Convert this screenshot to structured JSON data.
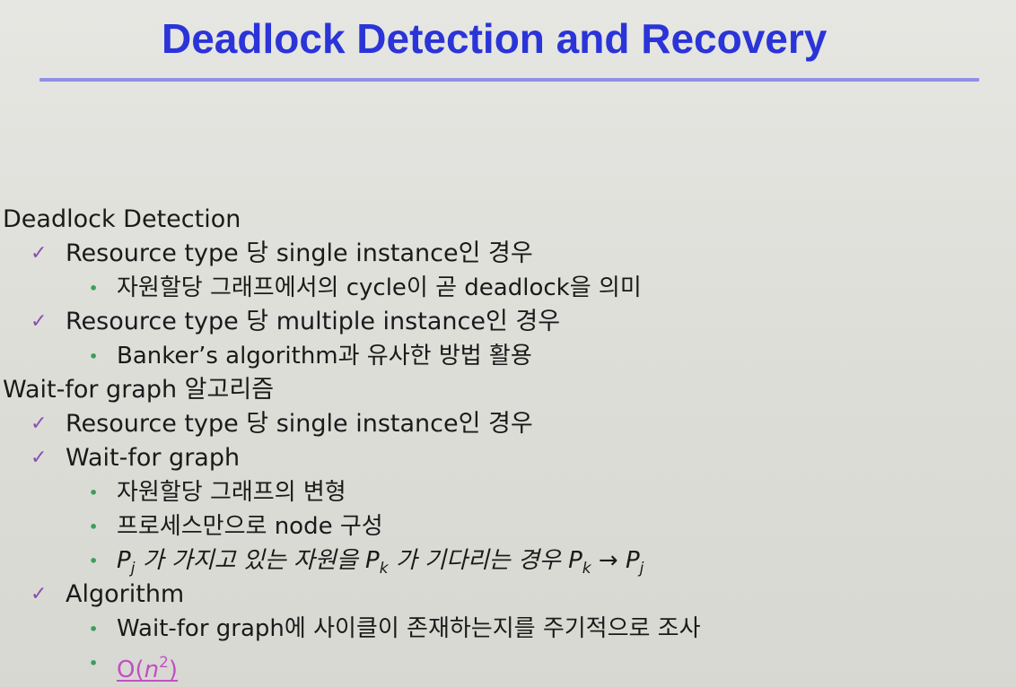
{
  "slide": {
    "title": "Deadlock Detection and Recovery",
    "sections": [
      {
        "heading": "Deadlock Detection",
        "items": [
          {
            "label": "Resource type 당 single instance인 경우",
            "subitems": [
              "자원할당 그래프에서의 cycle이 곧 deadlock을 의미"
            ]
          },
          {
            "label": "Resource type 당 multiple instance인 경우",
            "subitems": [
              "Banker’s algorithm과 유사한 방법 활용"
            ]
          }
        ]
      },
      {
        "heading": "Wait-for graph 알고리즘",
        "items": [
          {
            "label": "Resource type 당 single instance인 경우",
            "subitems": []
          },
          {
            "label": "Wait-for graph",
            "subitems": [
              "자원할당 그래프의 변형",
              "프로세스만으로 node 구성"
            ],
            "formula": {
              "p": "P",
              "j": "j",
              "k": "k",
              "text_a": "가 가지고 있는 자원을 ",
              "text_b": "가 기다리는 경우 ",
              "arrow": "→"
            }
          },
          {
            "label": "Algorithm",
            "subitems": [
              "Wait-for graph에 사이클이 존재하는지를 주기적으로 조사"
            ],
            "complexity": {
              "prefix": "O(",
              "var": "n",
              "exp": "2",
              "suffix": ")"
            }
          }
        ]
      }
    ]
  },
  "bullets": {
    "check": "✓",
    "dot": "•"
  },
  "colors": {
    "title": "#2a34d8",
    "rule": "#8f90e6",
    "check": "#8a4fb0",
    "dot": "#3d9e5a",
    "link": "#c24fc2"
  }
}
